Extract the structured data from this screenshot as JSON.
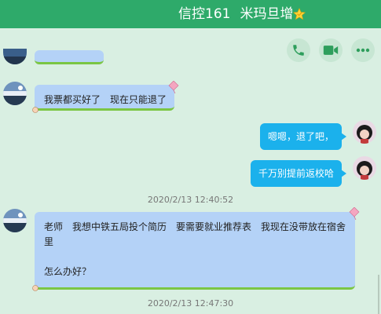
{
  "header": {
    "group_name": "信控161",
    "member_name": "米玛旦增",
    "color": "#2eaa6a"
  },
  "toolbar": {
    "phone_icon": "phone-icon",
    "video_icon": "video-icon",
    "more_icon": "more-icon"
  },
  "messages": [
    {
      "side": "left",
      "text": "我票都买好了　现在只能退了"
    },
    {
      "side": "right",
      "text": "嗯嗯，退了吧，"
    },
    {
      "side": "right",
      "text": "千万别提前返校哈"
    },
    {
      "time": "2020/2/13 12:40:52"
    },
    {
      "side": "left",
      "lines": [
        "老师　我想中铁五局投个简历　要需要就业推荐表　我现在没带放在宿舍",
        "里",
        "",
        "怎么办好？"
      ]
    },
    {
      "time": "2020/2/13 12:47:30"
    }
  ],
  "colors": {
    "background": "#d9efe2",
    "left_bubble": "#b4d2f7",
    "right_bubble": "#1bb1ec",
    "bubble_underline": "#7bc644"
  }
}
